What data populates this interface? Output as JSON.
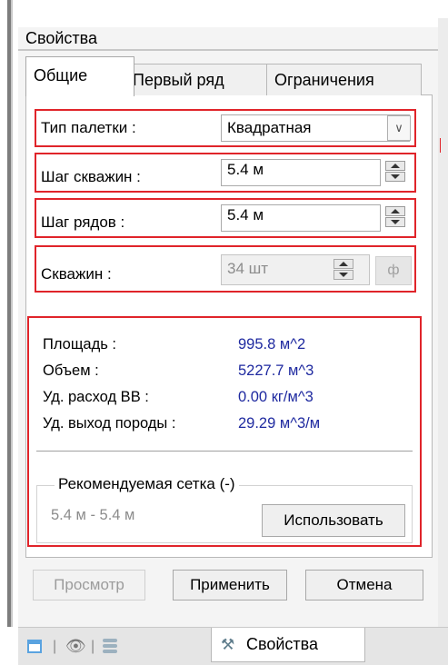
{
  "panel": {
    "title": "Свойства"
  },
  "tabs": [
    "Общие",
    "Первый ряд",
    "Ограничения"
  ],
  "fields": {
    "palette_type": {
      "label": "Тип палетки :",
      "value": "Квадратная"
    },
    "well_step": {
      "label": "Шаг скважин :",
      "value": "5.4 м"
    },
    "row_step": {
      "label": "Шаг рядов :",
      "value": "5.4 м"
    },
    "wells": {
      "label": "Скважин :",
      "value": "34 шт",
      "phi": "ф"
    }
  },
  "stats": [
    {
      "label": "Площадь :",
      "value": "995.8 м^2"
    },
    {
      "label": "Объем :",
      "value": "5227.7 м^3"
    },
    {
      "label": "Уд. расход ВВ :",
      "value": "0.00 кг/м^3"
    },
    {
      "label": "Уд. выход породы :",
      "value": "29.29 м^3/м"
    }
  ],
  "recommended": {
    "title": "Рекомендуемая сетка (-)",
    "value": "5.4  м - 5.4  м",
    "use_label": "Использовать"
  },
  "buttons": {
    "preview": "Просмотр",
    "apply": "Применить",
    "cancel": "Отмена"
  },
  "bottom_tabs": {
    "properties": "Свойства"
  },
  "colors": {
    "highlight": "#e0242a",
    "value_text": "#1f2aa0",
    "disabled_text": "#8c8c8c"
  }
}
